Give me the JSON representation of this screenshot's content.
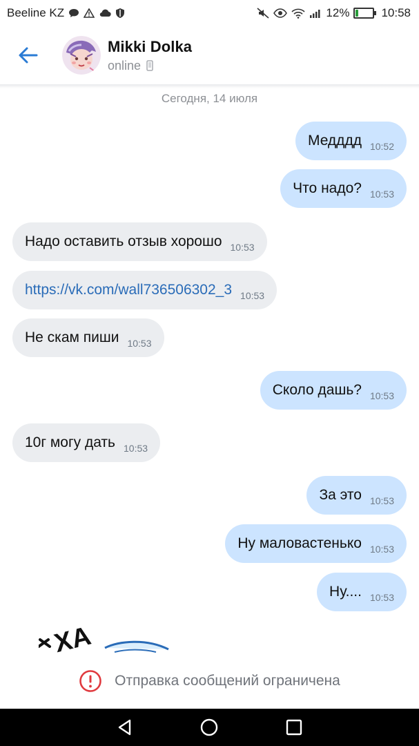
{
  "status_bar": {
    "carrier": "Beeline KZ",
    "battery_percent": "12%",
    "battery_level": 0.12,
    "time": "10:58"
  },
  "header": {
    "contact_name": "Mikki Dolka",
    "contact_status": "online"
  },
  "chat": {
    "date_separator": "Сегодня, 14 июля",
    "messages": [
      {
        "direction": "out",
        "text": "Медддд",
        "time": "10:52"
      },
      {
        "direction": "out",
        "text": "Что надо?",
        "time": "10:53"
      },
      {
        "direction": "in",
        "text": "Надо оставить отзыв хорошо",
        "time": "10:53"
      },
      {
        "direction": "in",
        "text": "https://vk.com/wall736506302_3",
        "time": "10:53",
        "is_link": true
      },
      {
        "direction": "in",
        "text": "Не скам пиши",
        "time": "10:53"
      },
      {
        "direction": "out",
        "text": "Сколо дашь?",
        "time": "10:53"
      },
      {
        "direction": "in",
        "text": "10г могу дать",
        "time": "10:53"
      },
      {
        "direction": "out",
        "text": "За это",
        "time": "10:53"
      },
      {
        "direction": "out",
        "text": "Ну маловастенько",
        "time": "10:53"
      },
      {
        "direction": "out",
        "text": "Ну....",
        "time": "10:53"
      }
    ],
    "sticker_text": "ХА"
  },
  "restriction": {
    "text": "Отправка сообщений ограничена"
  },
  "colors": {
    "accent": "#2a7bd4",
    "outgoing_bubble": "#cce4ff",
    "incoming_bubble": "#ebedf0",
    "warning": "#e0393e"
  }
}
